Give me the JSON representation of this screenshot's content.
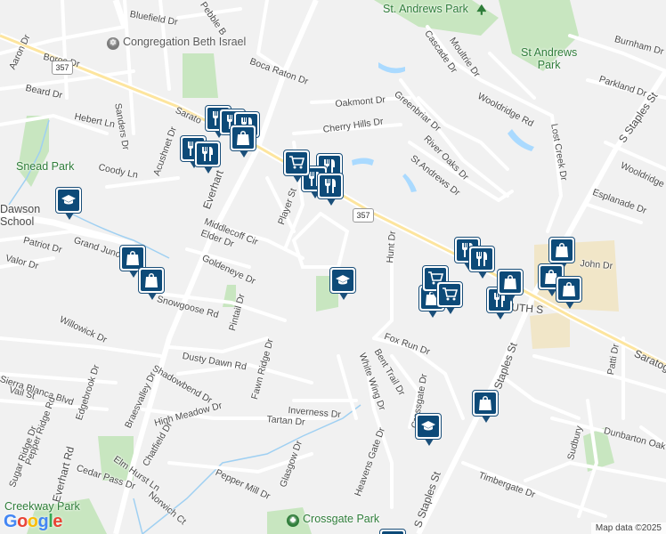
{
  "places": [
    {
      "key": "st_andrews_park_top",
      "text": "St. Andrews Park",
      "kind": "park"
    },
    {
      "key": "st_andrews_park",
      "text": "St Andrews\nPark",
      "kind": "park"
    },
    {
      "key": "beth_israel",
      "text": "Congregation Beth Israel",
      "kind": "worship"
    },
    {
      "key": "snead_park",
      "text": "Snead Park",
      "kind": "park"
    },
    {
      "key": "dawson_school",
      "text": "Dawson\nSchool",
      "kind": "school"
    },
    {
      "key": "creekway_park",
      "text": "Creekway Park",
      "kind": "park"
    },
    {
      "key": "crossgate_park",
      "text": "Crossgate Park",
      "kind": "park"
    }
  ],
  "streets": [
    {
      "text": "Bluefield Dr"
    },
    {
      "text": "Pebble B"
    },
    {
      "text": "Boca Raton Dr"
    },
    {
      "text": "Aaron Dr"
    },
    {
      "text": "Boros Dr"
    },
    {
      "text": "Beard Dr"
    },
    {
      "text": "Hebert Ln"
    },
    {
      "text": "Sanders Dr"
    },
    {
      "text": "Coody Ln"
    },
    {
      "text": "Acushnet Dr"
    },
    {
      "text": "Everhart"
    },
    {
      "text": "Player St"
    },
    {
      "text": "Middlecoff Cir"
    },
    {
      "text": "Elder Dr"
    },
    {
      "text": "Patriot Dr"
    },
    {
      "text": "Grand Junction"
    },
    {
      "text": "Valor Dr"
    },
    {
      "text": "Goldeneye Dr"
    },
    {
      "text": "Snowgoose Rd"
    },
    {
      "text": "Pintail Dr"
    },
    {
      "text": "Willowick Dr"
    },
    {
      "text": "Dusty Dawn Rd"
    },
    {
      "text": "Shadowbend Dr"
    },
    {
      "text": "Sierra Blanca Blvd"
    },
    {
      "text": "Vail St"
    },
    {
      "text": "Edgebrook Dr"
    },
    {
      "text": "Braesvalley Dr"
    },
    {
      "text": "High Meadow Dr"
    },
    {
      "text": "Fawn Ridge Dr"
    },
    {
      "text": "Inverness Dr"
    },
    {
      "text": "Tartan Dr"
    },
    {
      "text": "Chatfield Dr"
    },
    {
      "text": "Elm Hurst Ln"
    },
    {
      "text": "Cedar Pass Dr"
    },
    {
      "text": "Pepper Ridge Rd"
    },
    {
      "text": "Sugar Ridge Dr"
    },
    {
      "text": "Everhart Rd"
    },
    {
      "text": "Pepper Mill Dr"
    },
    {
      "text": "Glasgow Dr"
    },
    {
      "text": "Norwich Ct"
    },
    {
      "text": "Oakmont Dr"
    },
    {
      "text": "Cherry Hills Dr"
    },
    {
      "text": "Greenbriar Dr"
    },
    {
      "text": "River Oaks Dr"
    },
    {
      "text": "St Andrews Dr"
    },
    {
      "text": "Cascade Dr"
    },
    {
      "text": "Moultrie Dr"
    },
    {
      "text": "Wooldridge Rd"
    },
    {
      "text": "Parkland Dr"
    },
    {
      "text": "Lost Creek Dr"
    },
    {
      "text": "S Staples St"
    },
    {
      "text": "Esplanade Dr"
    },
    {
      "text": "Wooldridge"
    },
    {
      "text": "Burnham Dr"
    },
    {
      "text": "Hunt Dr"
    },
    {
      "text": "Fox Run Dr"
    },
    {
      "text": "Bent Trail Dr"
    },
    {
      "text": "White Wing Dr"
    },
    {
      "text": "Crossgate Dr"
    },
    {
      "text": "Heavens Gate Dr"
    },
    {
      "text": "S Staples St"
    },
    {
      "text": "S Staples St"
    },
    {
      "text": "Timbergate Dr"
    },
    {
      "text": "Dunbarton Oak"
    },
    {
      "text": "Patti Dr"
    },
    {
      "text": "Sudbury"
    },
    {
      "text": "Sarato"
    },
    {
      "text": "Saratog"
    },
    {
      "text": "John Dr"
    },
    {
      "text": "UTH S"
    }
  ],
  "highway_shields": [
    "357",
    "357"
  ],
  "attribution": {
    "logo": "Google",
    "text": "Map data ©2025"
  },
  "colors": {
    "park": "#c8e6c0",
    "water": "#aadaff",
    "road": "#ffffff",
    "arterial": "#fde293",
    "poi": "#0d4a78"
  }
}
